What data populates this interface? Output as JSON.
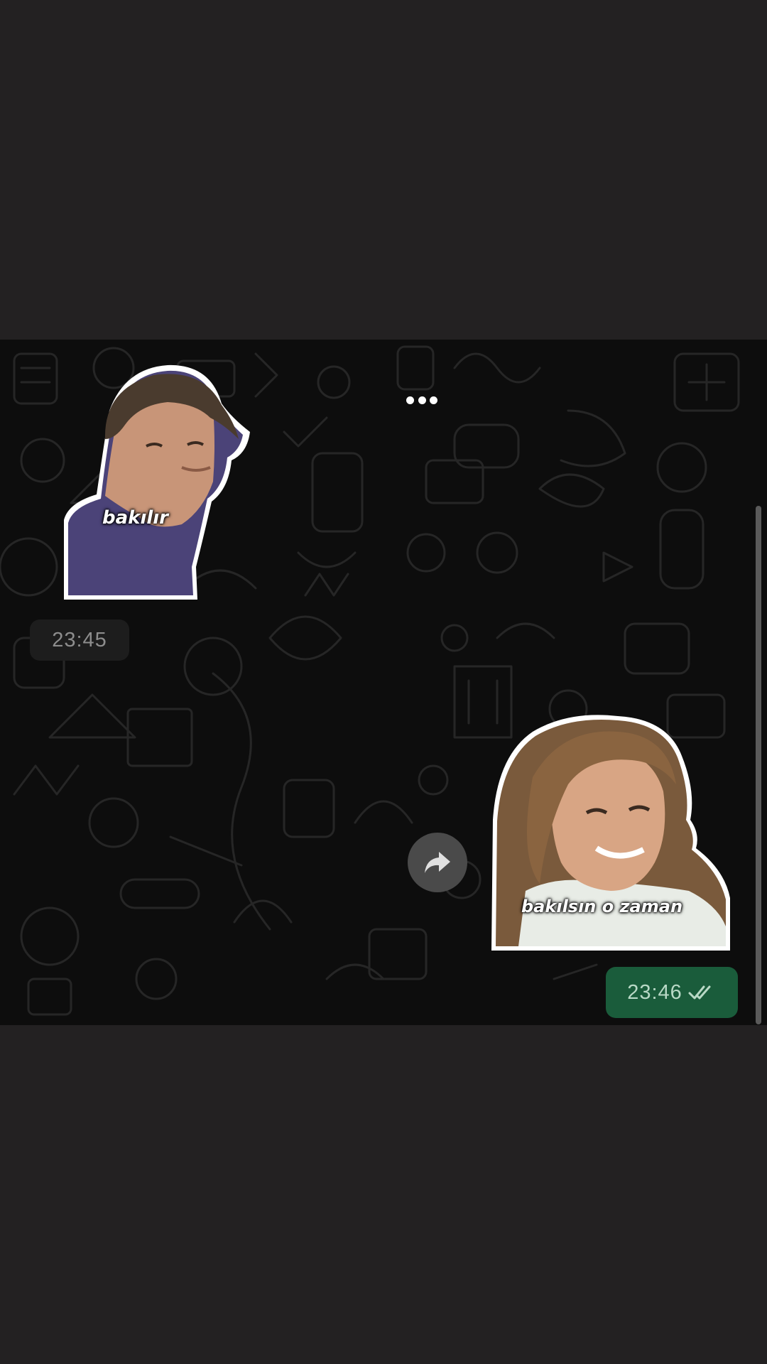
{
  "chat": {
    "typing_indicator": "...",
    "messages": [
      {
        "direction": "incoming",
        "type": "sticker",
        "sticker_caption": "bakılır",
        "time": "23:45"
      },
      {
        "direction": "outgoing",
        "type": "sticker",
        "sticker_caption": "bakılsın o zaman",
        "time": "23:46",
        "status_icon": "double-check-icon"
      }
    ],
    "forward_icon": "share-forward-icon"
  },
  "colors": {
    "page_background": "#232122",
    "chat_background": "#0d0d0d",
    "incoming_time_bg": "#1d1d1d",
    "outgoing_time_bg": "#1a5c3b",
    "forward_button_bg": "#4a4a4a"
  }
}
